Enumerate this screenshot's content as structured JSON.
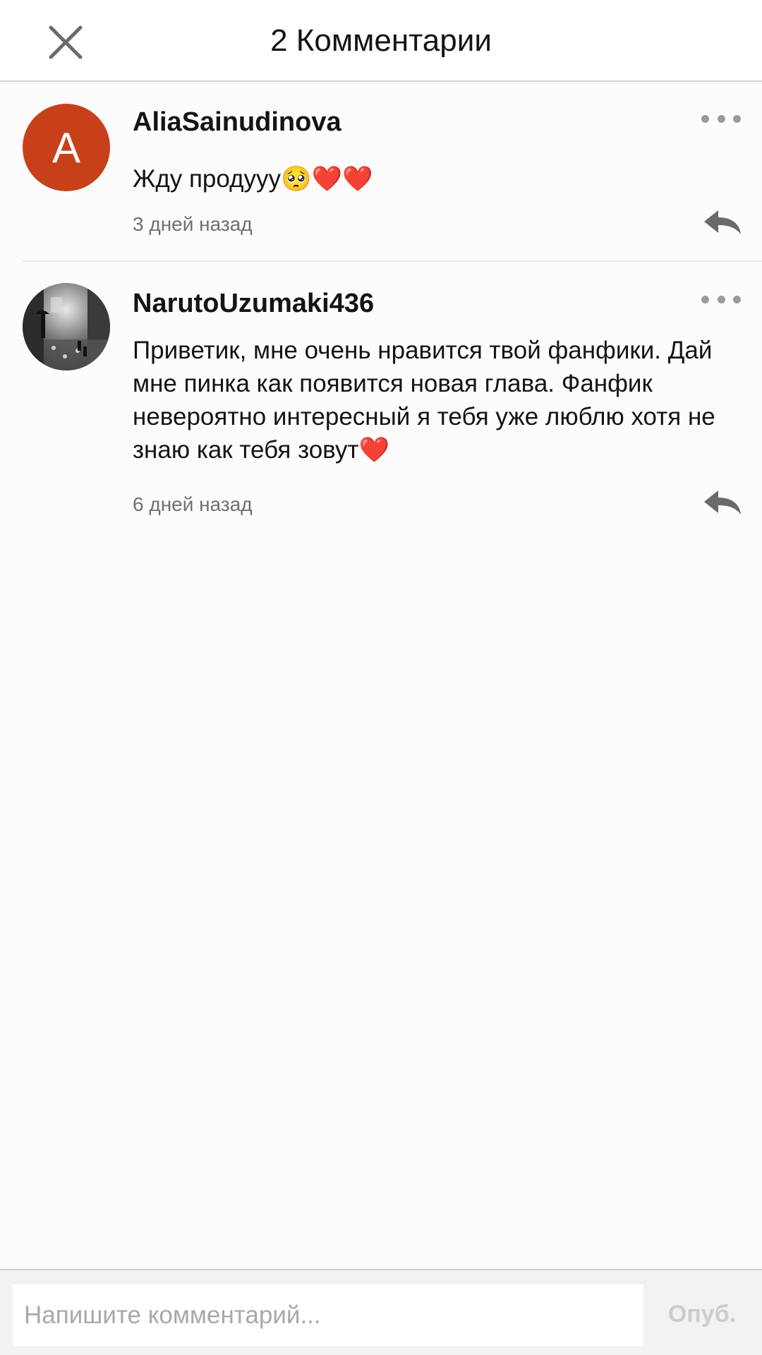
{
  "header": {
    "title": "2 Комментарии"
  },
  "comments": [
    {
      "username": "AliaSainudinova",
      "avatar_letter": "A",
      "avatar_color": "#c8401a",
      "text": "Жду продууу🥺❤️❤️",
      "timestamp": "3 дней назад"
    },
    {
      "username": "NarutoUzumaki436",
      "avatar_image": "photo-avatar",
      "text": "Приветик, мне очень нравится твой фанфики. Дай мне пинка как появится новая глава. Фанфик невероятно интересный я тебя уже люблю хотя не знаю как тебя зовут❤️",
      "timestamp": "6 дней назад"
    }
  ],
  "composer": {
    "placeholder": "Напишите комментарий...",
    "publish_label": "Опуб."
  },
  "icons": {
    "close": "close-icon",
    "more": "more-dots-icon",
    "reply": "reply-arrow-icon"
  }
}
